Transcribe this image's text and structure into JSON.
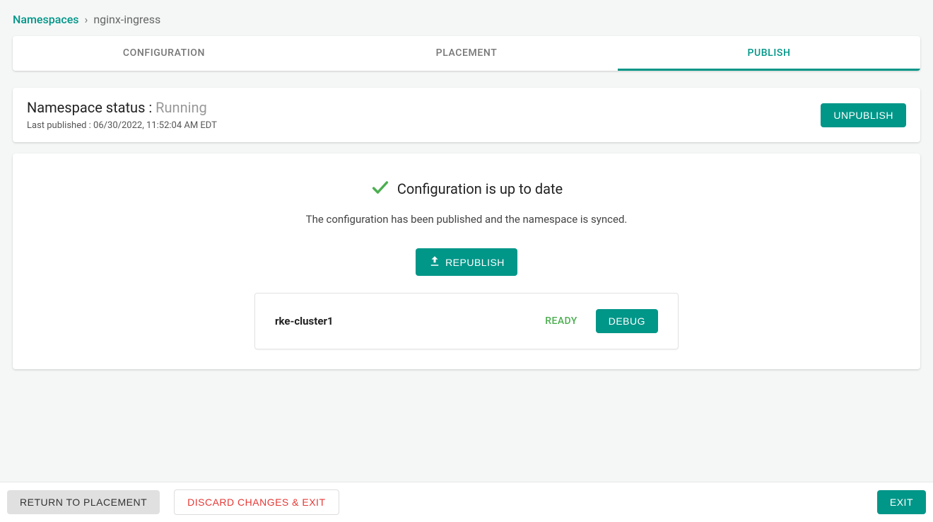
{
  "breadcrumb": {
    "root": "Namespaces",
    "separator": "›",
    "current": "nginx-ingress"
  },
  "tabs": {
    "configuration": "CONFIGURATION",
    "placement": "PLACEMENT",
    "publish": "PUBLISH"
  },
  "status": {
    "label": "Namespace status : ",
    "value": "Running",
    "last_published_label": "Last published : ",
    "last_published_value": "06/30/2022, 11:52:04 AM EDT",
    "unpublish_label": "UNPUBLISH"
  },
  "main": {
    "headline": "Configuration is up to date",
    "subtext": "The configuration has been published and the namespace is synced.",
    "republish_label": "REPUBLISH",
    "cluster": {
      "name": "rke-cluster1",
      "status": "READY",
      "debug_label": "DEBUG"
    }
  },
  "footer": {
    "return_label": "RETURN TO PLACEMENT",
    "discard_label": "DISCARD CHANGES & EXIT",
    "exit_label": "EXIT"
  },
  "colors": {
    "accent": "#009688",
    "success": "#4caf50",
    "danger": "#e53935"
  }
}
